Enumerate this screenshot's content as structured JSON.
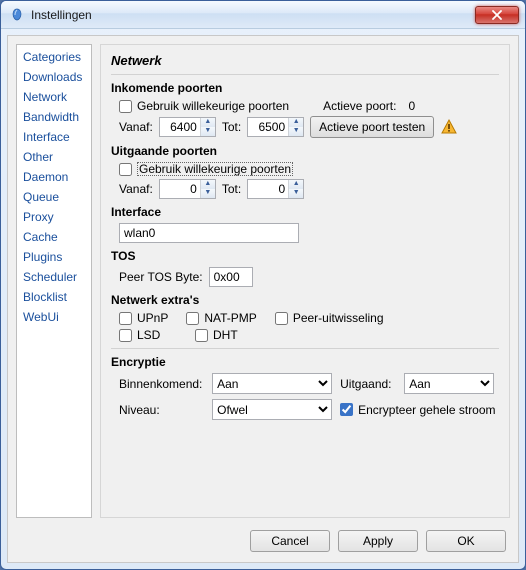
{
  "window": {
    "title": "Instellingen"
  },
  "sidebar": {
    "items": [
      "Categories",
      "Downloads",
      "Network",
      "Bandwidth",
      "Interface",
      "Other",
      "Daemon",
      "Queue",
      "Proxy",
      "Cache",
      "Plugins",
      "Scheduler",
      "Blocklist",
      "WebUi"
    ]
  },
  "page": {
    "title": "Netwerk"
  },
  "incoming": {
    "heading": "Inkomende poorten",
    "random_label": "Gebruik willekeurige poorten",
    "random_checked": false,
    "active_port_label": "Actieve poort:",
    "active_port_value": "0",
    "from_label": "Vanaf:",
    "from_value": "6400",
    "to_label": "Tot:",
    "to_value": "6500",
    "test_button": "Actieve poort testen"
  },
  "outgoing": {
    "heading": "Uitgaande poorten",
    "random_label": "Gebruik willekeurige poorten",
    "random_checked": false,
    "from_label": "Vanaf:",
    "from_value": "0",
    "to_label": "Tot:",
    "to_value": "0"
  },
  "interface": {
    "heading": "Interface",
    "value": "wlan0"
  },
  "tos": {
    "heading": "TOS",
    "label": "Peer TOS Byte:",
    "value": "0x00"
  },
  "extras": {
    "heading": "Netwerk extra's",
    "upnp": "UPnP",
    "natpmp": "NAT-PMP",
    "pex": "Peer-uitwisseling",
    "lsd": "LSD",
    "dht": "DHT"
  },
  "encryption": {
    "heading": "Encryptie",
    "incoming_label": "Binnenkomend:",
    "incoming_value": "Aan",
    "outgoing_label": "Uitgaand:",
    "outgoing_value": "Aan",
    "level_label": "Niveau:",
    "level_value": "Ofwel",
    "full_stream_label": "Encrypteer gehele stroom",
    "full_stream_checked": true
  },
  "footer": {
    "cancel": "Cancel",
    "apply": "Apply",
    "ok": "OK"
  }
}
